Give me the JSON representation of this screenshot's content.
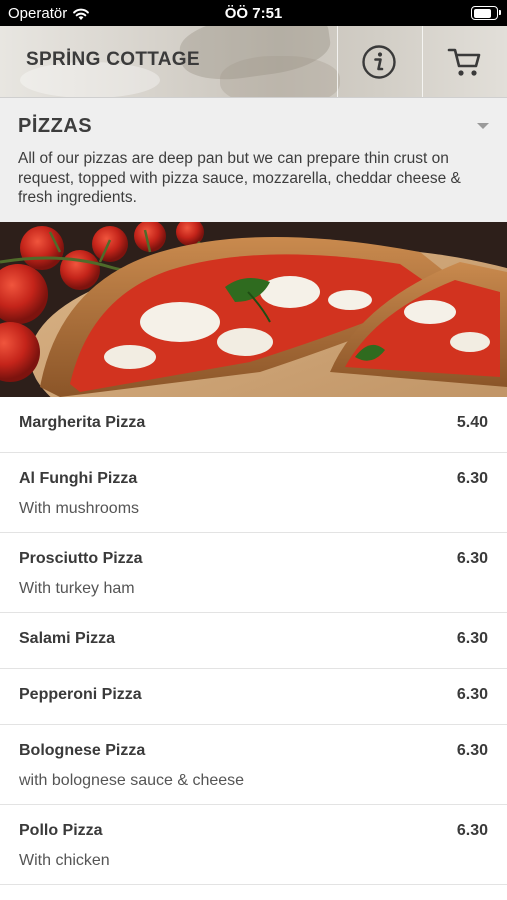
{
  "status_bar": {
    "carrier": "Operatör",
    "time": "ÖÖ 7:51",
    "wifi_icon": "wifi-icon",
    "battery_icon": "battery-icon",
    "battery_level": 0.85
  },
  "header": {
    "brand": "SPRİNG COTTAGE",
    "info_icon": "info-icon",
    "cart_icon": "cart-icon"
  },
  "category": {
    "title": "PİZZAS",
    "description": "All of our pizzas are deep pan but we can prepare thin crust on request, topped with pizza sauce, mozzarella, cheddar cheese & fresh ingredients.",
    "toggle_icon": "caret-down-icon"
  },
  "hero_image": "pizza-photo",
  "menu": [
    {
      "name": "Margherita Pizza",
      "price": "5.40",
      "description": ""
    },
    {
      "name": "Al Funghi Pizza",
      "price": "6.30",
      "description": "With mushrooms"
    },
    {
      "name": "Prosciutto Pizza",
      "price": "6.30",
      "description": "With turkey ham"
    },
    {
      "name": "Salami Pizza",
      "price": "6.30",
      "description": ""
    },
    {
      "name": "Pepperoni Pizza",
      "price": "6.30",
      "description": ""
    },
    {
      "name": "Bolognese Pizza",
      "price": "6.30",
      "description": "with bolognese sauce & cheese"
    },
    {
      "name": "Pollo Pizza",
      "price": "6.30",
      "description": "With chicken"
    }
  ],
  "colors": {
    "status_bar": "#000000",
    "category_bg": "#efefef",
    "text": "#3a3a3a",
    "divider": "#e3e3e3"
  }
}
